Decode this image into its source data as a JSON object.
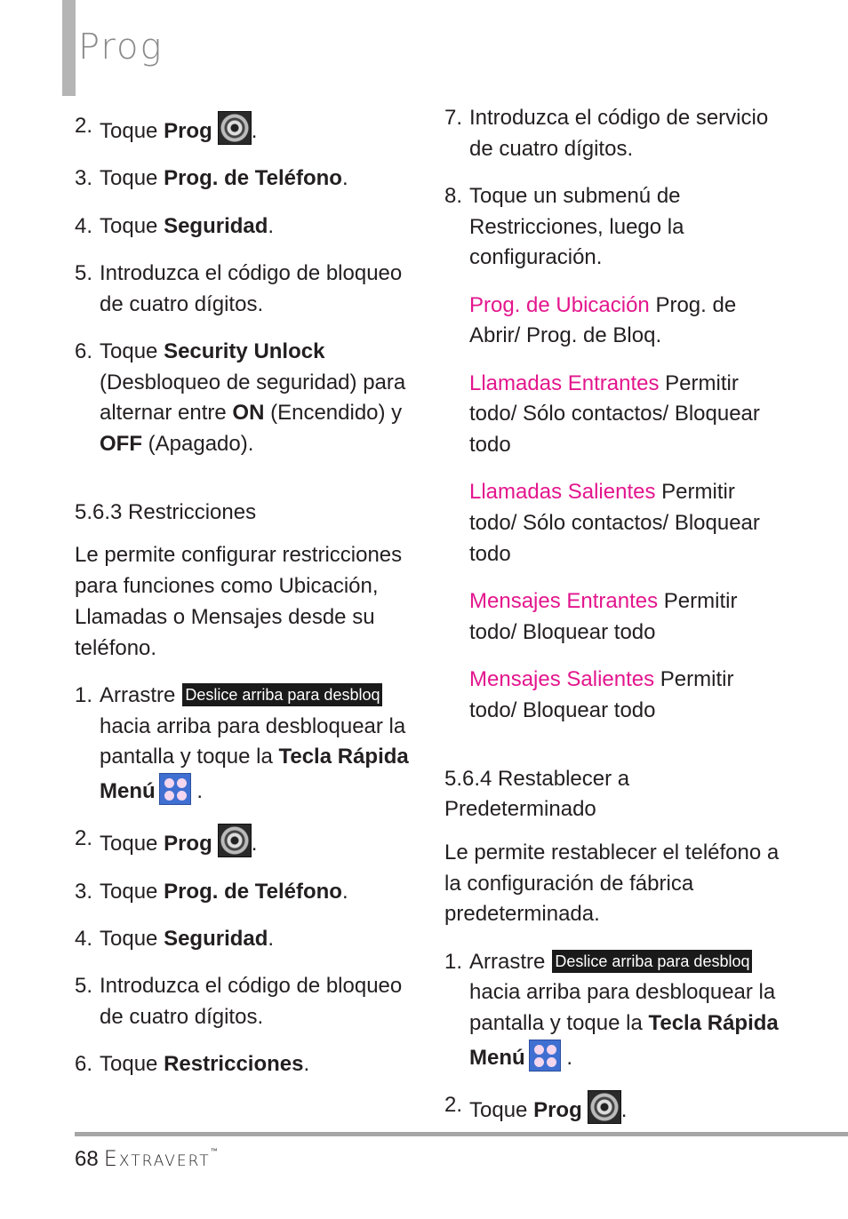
{
  "header": {
    "title": "Prog"
  },
  "left_column": {
    "steps_a": [
      {
        "num": "2.",
        "pre": "Toque ",
        "bold": "Prog",
        "icon": "gear-icon",
        "post": "."
      },
      {
        "num": "3.",
        "pre": "Toque ",
        "bold": "Prog. de Teléfono",
        "post": "."
      },
      {
        "num": "4.",
        "pre": "Toque ",
        "bold": "Seguridad",
        "post": "."
      },
      {
        "num": "5.",
        "text": "Introduzca el código de bloqueo de cuatro dígitos."
      },
      {
        "num": "6.",
        "pre": "Toque ",
        "bold": "Security Unlock",
        "mid1": " (Desbloqueo de seguridad) para alternar entre ",
        "bold2": "ON",
        "mid2": " (Encendido) y ",
        "bold3": "OFF",
        "post": " (Apagado)."
      }
    ],
    "section_heading": "5.6.3 Restricciones",
    "section_para": "Le permite configurar restricciones para funciones como Ubicación, Llamadas o Mensajes desde su teléfono.",
    "steps_b": [
      {
        "num": "1.",
        "pre": "Arrastre",
        "slider": "Deslice arriba para desbloq",
        "mid": " hacia arriba para desbloquear la pantalla y toque la ",
        "bold": "Tecla Rápida Menú",
        "icon": "menu-grid-icon",
        "post": "."
      },
      {
        "num": "2.",
        "pre": "Toque ",
        "bold": "Prog",
        "icon": "gear-icon",
        "post": "."
      },
      {
        "num": "3.",
        "pre": "Toque ",
        "bold": "Prog. de Teléfono",
        "post": "."
      },
      {
        "num": "4.",
        "pre": "Toque ",
        "bold": "Seguridad",
        "post": "."
      },
      {
        "num": "5.",
        "text": "Introduzca el código de bloqueo de cuatro dígitos."
      },
      {
        "num": "6.",
        "pre": "Toque ",
        "bold": "Restricciones",
        "post": "."
      }
    ]
  },
  "right_column": {
    "steps": [
      {
        "num": "7.",
        "text": "Introduzca el código de servicio de cuatro dígitos."
      },
      {
        "num": "8.",
        "text": "Toque un submenú de Restricciones, luego la configuración."
      }
    ],
    "submenus": [
      {
        "label": "Prog. de Ubicación",
        "options": "Prog. de Abrir/ Prog. de Bloq."
      },
      {
        "label": "Llamadas Entrantes",
        "options": "Permitir todo/ Sólo contactos/ Bloquear todo"
      },
      {
        "label": "Llamadas Salientes",
        "options": "Permitir todo/ Sólo contactos/ Bloquear todo"
      },
      {
        "label": "Mensajes Entrantes",
        "options": "Permitir todo/ Bloquear todo"
      },
      {
        "label": "Mensajes Salientes",
        "options": "Permitir todo/ Bloquear todo"
      }
    ],
    "section_heading": "5.6.4 Restablecer a Predeterminado",
    "section_para": "Le permite restablecer el teléfono a la configuración de fábrica predeterminada.",
    "steps_b": [
      {
        "num": "1.",
        "pre": "Arrastre",
        "slider": "Deslice arriba para desbloq",
        "mid": " hacia arriba para desbloquear la pantalla y toque la ",
        "bold": "Tecla Rápida Menú",
        "icon": "menu-grid-icon",
        "post": "."
      },
      {
        "num": "2.",
        "pre": "Toque ",
        "bold": "Prog",
        "icon": "gear-icon",
        "post": "."
      }
    ]
  },
  "colors": {
    "accent_pink": "#e3168d",
    "title_gray": "#8a8a8a",
    "bar_gray": "#b5b5b5"
  },
  "footer": {
    "page_number": "68",
    "brand": "Extravert",
    "trademark": "™"
  }
}
